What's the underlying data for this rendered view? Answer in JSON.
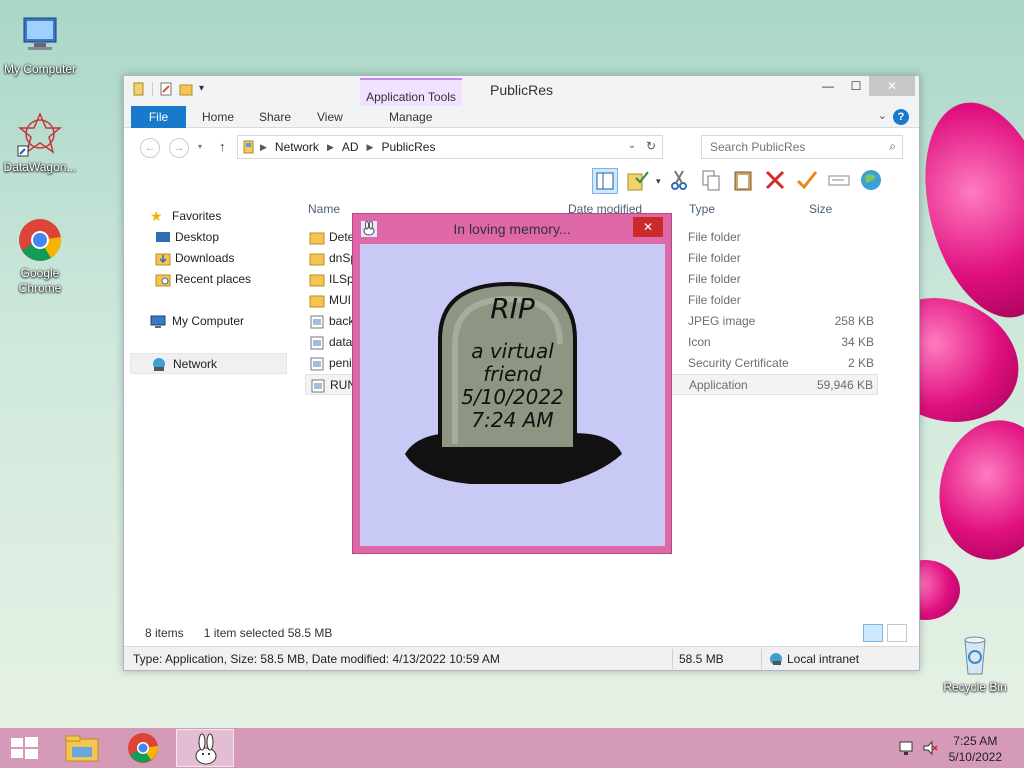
{
  "desktop": {
    "icons": [
      {
        "label": "My Computer"
      },
      {
        "label": "DataWagon..."
      },
      {
        "label": "Google Chrome"
      },
      {
        "label": "Recycle Bin"
      }
    ]
  },
  "window": {
    "title": "PublicRes",
    "context_group": "Application Tools",
    "tabs": [
      "File",
      "Home",
      "Share",
      "View",
      "Manage"
    ],
    "address": {
      "crumbs": [
        "Network",
        "AD",
        "PublicRes"
      ]
    },
    "search": {
      "placeholder": "Search PublicRes"
    },
    "nav": {
      "favorites": "Favorites",
      "desktop": "Desktop",
      "downloads": "Downloads",
      "recent": "Recent places",
      "my_computer": "My Computer",
      "network": "Network"
    },
    "columns": {
      "name": "Name",
      "date": "Date modified",
      "type": "Type",
      "size": "Size"
    },
    "files": [
      {
        "name": "Dete",
        "type": "File folder",
        "size": ""
      },
      {
        "name": "dnSp",
        "type": "File folder",
        "size": ""
      },
      {
        "name": "ILSpy",
        "type": "File folder",
        "size": ""
      },
      {
        "name": "MUI",
        "type": "File folder",
        "size": ""
      },
      {
        "name": "back",
        "type": "JPEG image",
        "size": "258 KB"
      },
      {
        "name": "data",
        "type": "Icon",
        "size": "34 KB"
      },
      {
        "name": "peni",
        "type": "Security Certificate",
        "size": "2 KB"
      },
      {
        "name": "RUN",
        "type": "Application",
        "size": "59,946 KB"
      }
    ],
    "status": {
      "count": "8 items",
      "selection": "1 item selected  58.5 MB"
    },
    "details": {
      "info": "Type: Application, Size: 58.5 MB, Date modified: 4/13/2022 10:59 AM",
      "size": "58.5 MB",
      "zone": "Local intranet"
    }
  },
  "popup": {
    "title": "In loving memory...",
    "close": "✕",
    "tomb": {
      "line1": "RIP",
      "line2": "a virtual",
      "line3": "friend",
      "line4": "5/10/2022",
      "line5": "7:24 AM"
    }
  },
  "taskbar": {
    "time": "7:25 AM",
    "date": "5/10/2022"
  },
  "colors": {
    "accent": "#1979ca",
    "popup_frame": "#df68a9",
    "popup_bg": "#c9c9f5",
    "taskbar": "#d59ab8"
  }
}
